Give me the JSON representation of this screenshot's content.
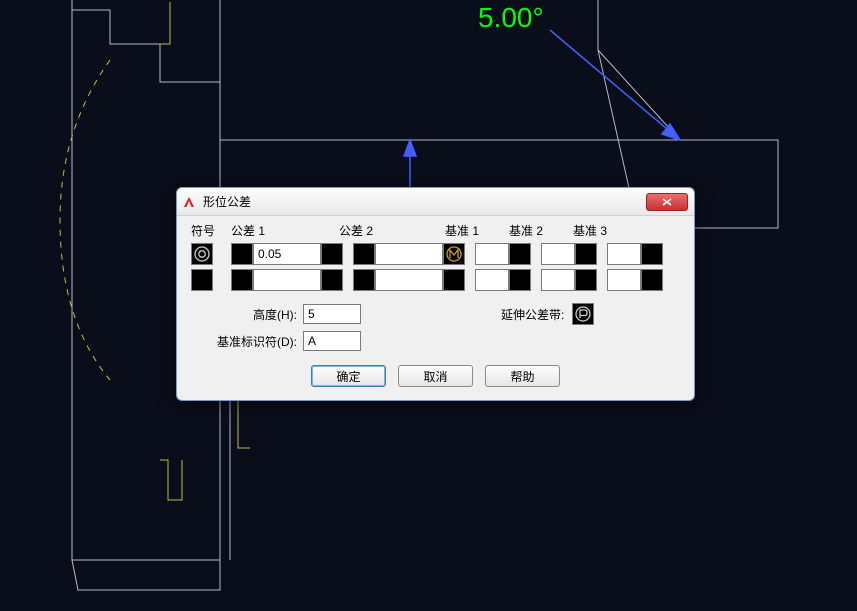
{
  "canvas": {
    "dimension_text": "5.00°"
  },
  "dialog": {
    "title": "形位公差",
    "headers": {
      "symbol": "符号",
      "tol1": "公差 1",
      "tol2": "公差 2",
      "datum1": "基准 1",
      "datum2": "基准 2",
      "datum3": "基准 3"
    },
    "rows": [
      {
        "symbol_icon": "concentricity-icon",
        "tol1_value": "0.05",
        "tol1_mc": "",
        "tol2_value": "",
        "tol2_mc_icon": "mmc-icon",
        "d1": "",
        "d2": "",
        "d3": ""
      },
      {
        "symbol_icon": "",
        "tol1_value": "",
        "tol1_mc": "",
        "tol2_value": "",
        "tol2_mc_icon": "",
        "d1": "",
        "d2": "",
        "d3": ""
      }
    ],
    "height_label": "高度(H):",
    "height_value": "5",
    "proj_label": "延伸公差带:",
    "proj_icon": "projected-zone-icon",
    "datum_id_label": "基准标识符(D):",
    "datum_id_value": "A",
    "buttons": {
      "ok": "确定",
      "cancel": "取消",
      "help": "帮助"
    }
  }
}
